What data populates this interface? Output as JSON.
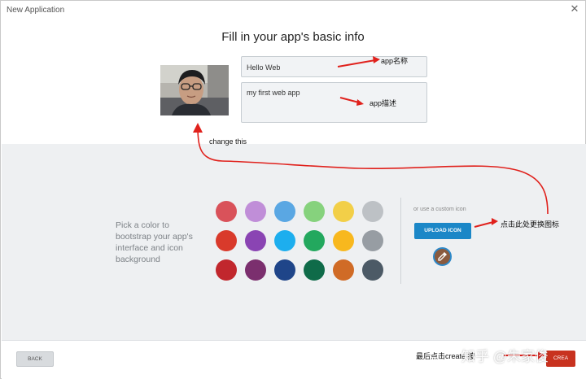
{
  "window": {
    "title": "New Application",
    "close_glyph": "✕"
  },
  "heading": "Fill in your app's basic info",
  "form": {
    "name_value": "Hello Web",
    "description_value": "my first web app"
  },
  "color_section": {
    "prompt": "Pick a color to bootstrap your app's interface and icon background",
    "swatches": [
      [
        "#d9525a",
        "#c08ed8",
        "#5aa7e3",
        "#86d27d",
        "#f2cf48",
        "#bdc1c5"
      ],
      [
        "#d93a2b",
        "#8a44b3",
        "#1daeee",
        "#23a85e",
        "#f8b81e",
        "#979da3"
      ],
      [
        "#c1272d",
        "#7b2f6e",
        "#1f4589",
        "#0f6b49",
        "#d06b26",
        "#4c5a66"
      ]
    ]
  },
  "custom_icon": {
    "caption": "or use a custom icon",
    "upload_label": "UPLOAD ICON",
    "picker_icon": "eyedropper-icon"
  },
  "footer": {
    "back_label": "BACK",
    "create_label": "CREA"
  },
  "annotations": {
    "name_note": "app名称",
    "description_note": "app描述",
    "photo_note": "change this",
    "upload_note": "点击此处更换图标",
    "create_note": "最后点击create 按",
    "watermark": "知乎 @朱家俊"
  },
  "colors": {
    "annotation_red": "#e0211c",
    "upload_blue": "#1b87c7",
    "create_red": "#c8321f",
    "lower_bg": "#eef0f2"
  }
}
